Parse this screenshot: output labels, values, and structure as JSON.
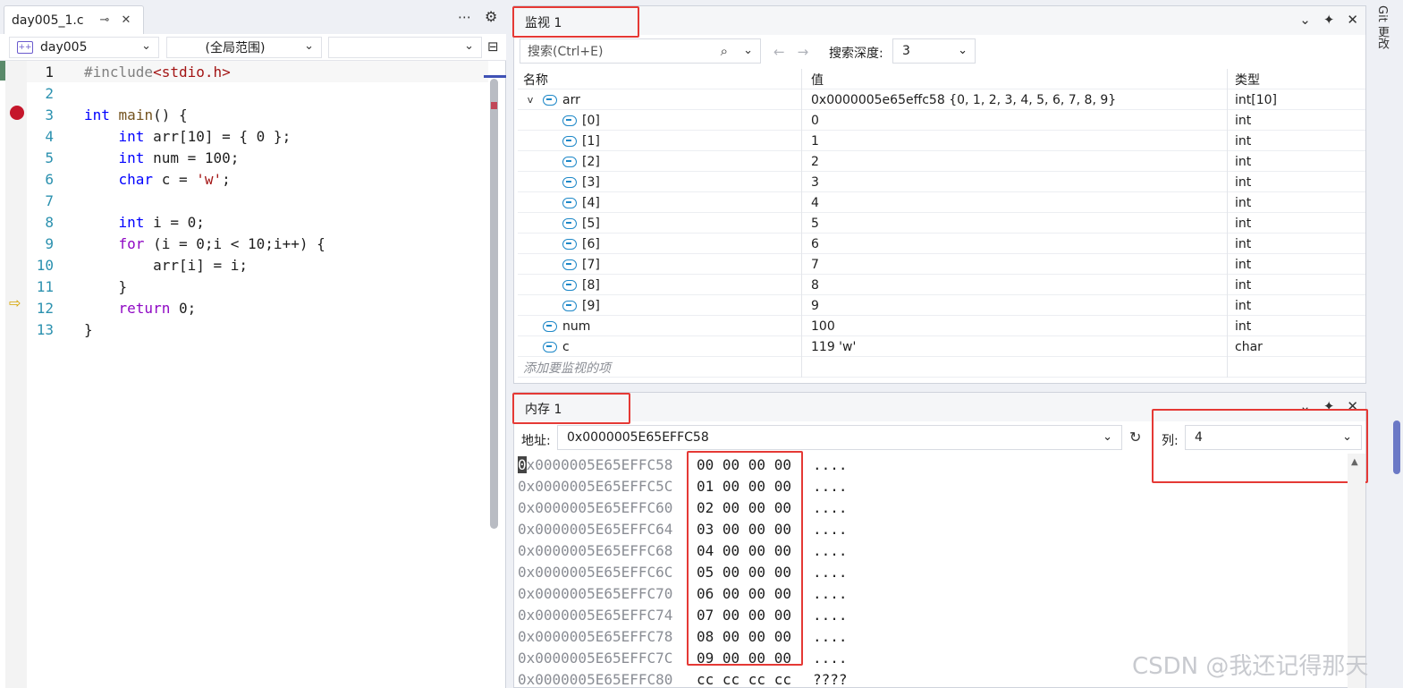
{
  "editor": {
    "tab_title": "day005_1.c",
    "pin_glyph": "⊸",
    "close_glyph": "✕",
    "more_glyph": "⋯",
    "gear_glyph": "⚙",
    "project": "day005",
    "scope": "(全局范围)",
    "member": "",
    "lines": [
      {
        "n": "1"
      },
      {
        "n": "2"
      },
      {
        "n": "3"
      },
      {
        "n": "4"
      },
      {
        "n": "5"
      },
      {
        "n": "6"
      },
      {
        "n": "7"
      },
      {
        "n": "8"
      },
      {
        "n": "9"
      },
      {
        "n": "10"
      },
      {
        "n": "11"
      },
      {
        "n": "12"
      },
      {
        "n": "13"
      }
    ],
    "code": {
      "l1_pp": "#include",
      "l1_hdr": "<stdio.h>",
      "l3_kw": "int",
      "l3_fn": "main",
      "l3_rest": "() {",
      "l4_kw": "int",
      "l4_rest": " arr[10] = { 0 };",
      "l5_kw": "int",
      "l5_rest": " num = 100;",
      "l6_kw": "char",
      "l6_mid": " c = ",
      "l6_str": "'w'",
      "l6_end": ";",
      "l8_kw": "int",
      "l8_rest": " i = 0;",
      "l9_kw": "for",
      "l9_rest": " (i = 0;i < 10;i++) {",
      "l10": "arr[i] = i;",
      "l11": "}",
      "l12_kw": "return",
      "l12_rest": " 0;",
      "l13": "}"
    }
  },
  "watch": {
    "title": "监视 1",
    "search_placeholder": "搜索(Ctrl+E)",
    "depth_label": "搜索深度:",
    "depth_value": "3",
    "headers": {
      "name": "名称",
      "value": "值",
      "type": "类型"
    },
    "rows": [
      {
        "name": "arr",
        "value": "0x0000005e65effc58 {0, 1, 2, 3, 4, 5, 6, 7, 8, 9}",
        "type": "int[10]"
      },
      {
        "name": "[0]",
        "value": "0",
        "type": "int"
      },
      {
        "name": "[1]",
        "value": "1",
        "type": "int"
      },
      {
        "name": "[2]",
        "value": "2",
        "type": "int"
      },
      {
        "name": "[3]",
        "value": "3",
        "type": "int"
      },
      {
        "name": "[4]",
        "value": "4",
        "type": "int"
      },
      {
        "name": "[5]",
        "value": "5",
        "type": "int"
      },
      {
        "name": "[6]",
        "value": "6",
        "type": "int"
      },
      {
        "name": "[7]",
        "value": "7",
        "type": "int"
      },
      {
        "name": "[8]",
        "value": "8",
        "type": "int"
      },
      {
        "name": "[9]",
        "value": "9",
        "type": "int"
      },
      {
        "name": "num",
        "value": "100",
        "type": "int"
      },
      {
        "name": "c",
        "value": "119 'w'",
        "type": "char"
      }
    ],
    "add_item": "添加要监视的项"
  },
  "memory": {
    "title": "内存 1",
    "address_label": "地址:",
    "address_value": "0x0000005E65EFFC58",
    "columns_label": "列:",
    "columns_value": "4",
    "lines": [
      {
        "addr": "0x0000005E65EFFC58",
        "bytes": "00 00 00 00",
        "chars": "...."
      },
      {
        "addr": "0x0000005E65EFFC5C",
        "bytes": "01 00 00 00",
        "chars": "...."
      },
      {
        "addr": "0x0000005E65EFFC60",
        "bytes": "02 00 00 00",
        "chars": "...."
      },
      {
        "addr": "0x0000005E65EFFC64",
        "bytes": "03 00 00 00",
        "chars": "...."
      },
      {
        "addr": "0x0000005E65EFFC68",
        "bytes": "04 00 00 00",
        "chars": "...."
      },
      {
        "addr": "0x0000005E65EFFC6C",
        "bytes": "05 00 00 00",
        "chars": "...."
      },
      {
        "addr": "0x0000005E65EFFC70",
        "bytes": "06 00 00 00",
        "chars": "...."
      },
      {
        "addr": "0x0000005E65EFFC74",
        "bytes": "07 00 00 00",
        "chars": "...."
      },
      {
        "addr": "0x0000005E65EFFC78",
        "bytes": "08 00 00 00",
        "chars": "...."
      },
      {
        "addr": "0x0000005E65EFFC7C",
        "bytes": "09 00 00 00",
        "chars": "...."
      },
      {
        "addr": "0x0000005E65EFFC80",
        "bytes": "cc cc cc cc",
        "chars": "????"
      }
    ]
  },
  "right_strip": {
    "label": "Git 更改"
  },
  "watermark": "CSDN @我还记得那天",
  "colors": {
    "highlight": "#e53935",
    "breakpoint": "#c5162b",
    "keyword": "#0000ff",
    "control": "#8f08c4"
  },
  "icons": [
    "pin-icon",
    "close-icon",
    "more-icon",
    "gear-icon",
    "search-icon",
    "refresh-icon",
    "breakpoint-icon",
    "current-line-arrow-icon",
    "object-icon"
  ]
}
